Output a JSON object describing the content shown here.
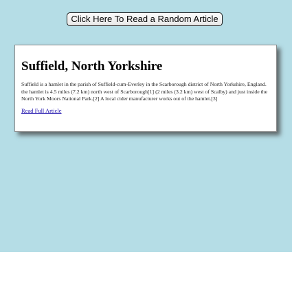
{
  "toolbar": {
    "random_article_label": "Click Here To Read a Random Article"
  },
  "article": {
    "title": "Suffield, North Yorkshire",
    "summary": "Suffield is a hamlet in the parish of Suffield-cum-Everley in the Scarborough district of North Yorkshire, England. the hamlet is 4.5 miles (7.2 km) north west of Scarborough[1] (2 miles (3.2 km) west of Scalby) and just inside the North York Moors National Park.[2] A local cider manufacturer works out of the hamlet.[3]",
    "read_more_label": "Read Full Article"
  },
  "colors": {
    "background": "#b5dde6",
    "card": "#ffffff",
    "link": "#1a0dab"
  }
}
